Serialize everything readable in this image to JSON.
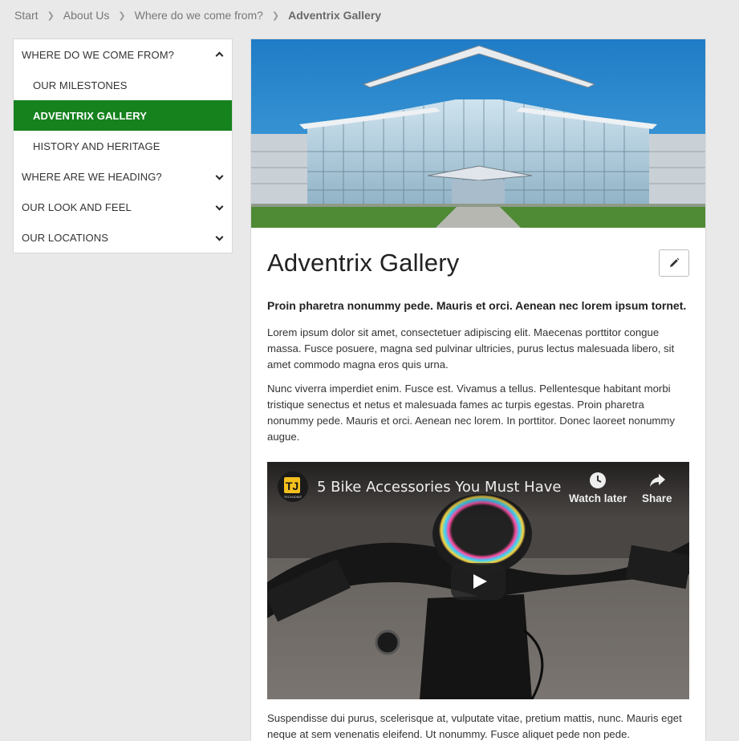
{
  "breadcrumb": {
    "items": [
      "Start",
      "About Us",
      "Where do we come from?"
    ],
    "current": "Adventrix Gallery"
  },
  "sidebar": {
    "items": [
      {
        "label": "WHERE DO WE COME FROM?",
        "chevron": "up"
      },
      {
        "label": "OUR MILESTONES",
        "child": true
      },
      {
        "label": "ADVENTRIX GALLERY",
        "child": true,
        "active": true
      },
      {
        "label": "HISTORY AND HERITAGE",
        "child": true
      },
      {
        "label": "WHERE ARE WE HEADING?",
        "chevron": "down"
      },
      {
        "label": "OUR LOOK AND FEEL",
        "chevron": "down"
      },
      {
        "label": "OUR LOCATIONS",
        "chevron": "down"
      }
    ],
    "active_color": "#15821e"
  },
  "main": {
    "title": "Adventrix Gallery",
    "edit_icon": "pencil-icon",
    "lead": "Proin pharetra nonummy pede. Mauris et orci. Aenean nec lorem ipsum tornet.",
    "paragraph_1": "Lorem ipsum dolor sit amet, consectetuer adipiscing elit. Maecenas porttitor congue massa. Fusce posuere, magna sed pulvinar ultricies, purus lectus malesuada libero, sit amet commodo magna eros quis urna.",
    "paragraph_2": "Nunc viverra imperdiet enim. Fusce est. Vivamus a tellus. Pellentesque habitant morbi tristique senectus et netus et malesuada fames ac turpis egestas. Proin pharetra nonummy pede. Mauris et orci. Aenean nec lorem. In porttitor. Donec laoreet nonummy augue.",
    "paragraph_3": "Suspendisse dui purus, scelerisque at, vulputate vitae, pretium mattis, nunc. Mauris eget neque at sem venenatis eleifend. Ut nonummy. Fusce aliquet pede non pede."
  },
  "video": {
    "title": "5 Bike Accessories You Must Have",
    "channel_logo_text": "TJ",
    "channel_logo_subtext": "TECHJOINT",
    "watch_later": "Watch later",
    "share": "Share"
  }
}
